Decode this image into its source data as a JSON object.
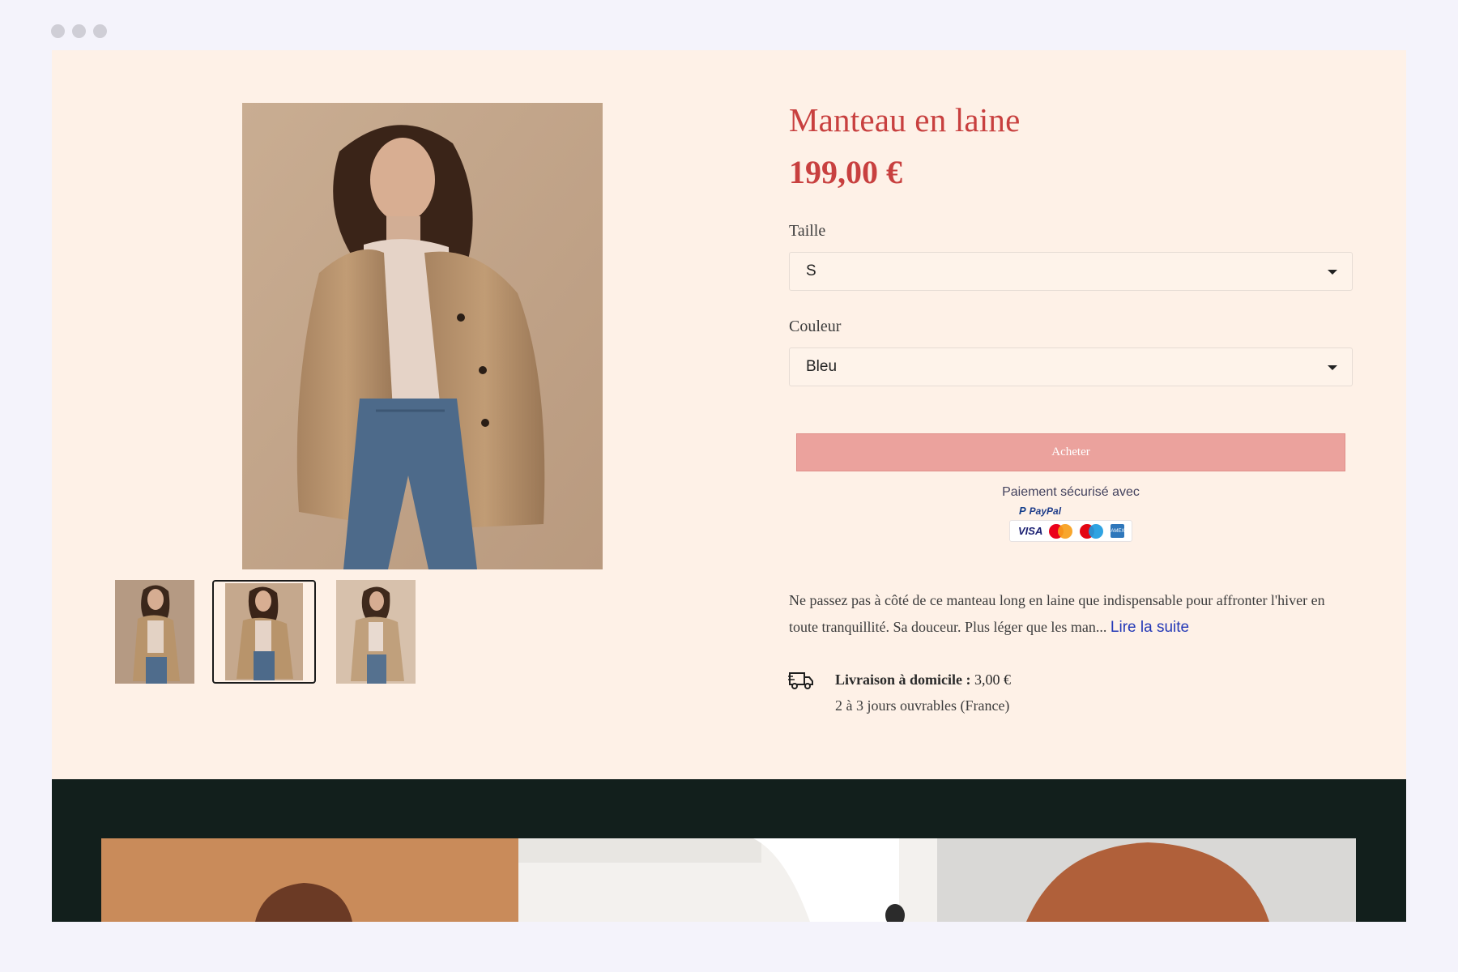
{
  "product": {
    "title": "Manteau en laine",
    "price": "199,00 €",
    "size": {
      "label": "Taille",
      "value": "S"
    },
    "color": {
      "label": "Couleur",
      "value": "Bleu"
    },
    "buy_label": "Acheter",
    "secure_payment": "Paiement sécurisé avec",
    "payments": {
      "paypal": "PayPal",
      "visa": "VISA",
      "amex": "AMEX"
    },
    "description": "Ne passez pas à côté de ce manteau long en laine que indispensable pour affronter l'hiver en toute tranquillité. Sa douceur. Plus léger que les man...",
    "read_more": "Lire la suite",
    "shipping": {
      "title": "Livraison à domicile :",
      "price": "3,00 €",
      "delay": "2 à 3 jours ouvrables (France)"
    },
    "gallery": {
      "thumbnails": 3,
      "selected": 2
    }
  },
  "colors": {
    "accent": "#c8403f",
    "button": "#eba29d",
    "panel": "#fef1e7",
    "dark_section": "#121f1c",
    "link": "#2439b7"
  }
}
